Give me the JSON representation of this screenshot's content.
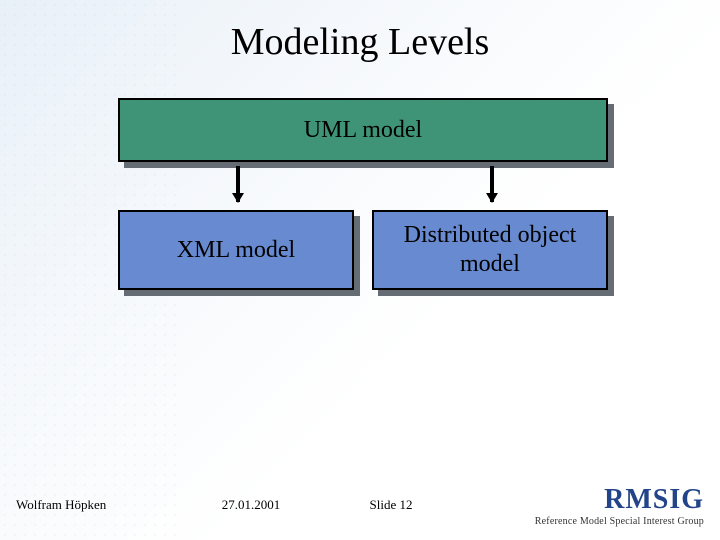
{
  "slide": {
    "title": "Modeling Levels",
    "boxes": {
      "top": "UML model",
      "left": "XML model",
      "right": "Distributed object\nmodel"
    },
    "footer": {
      "author": "Wolfram Höpken",
      "date": "27.01.2001",
      "slide_label": "Slide 12",
      "brand_acronym": "RMSIG",
      "brand_tagline": "Reference Model Special Interest Group"
    }
  },
  "colors": {
    "green": "#3f9478",
    "blue": "#678ad0",
    "brand": "#224488"
  }
}
